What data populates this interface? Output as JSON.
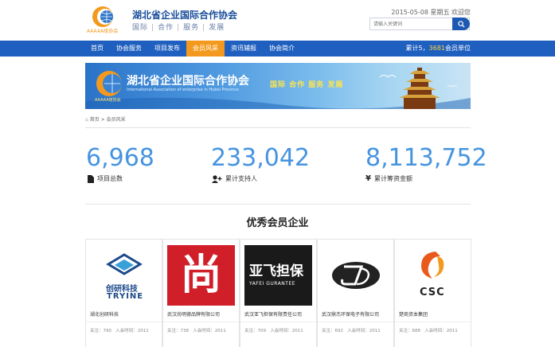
{
  "header": {
    "site_name": "湖北省企业国际合作协会",
    "slogan": [
      "国际",
      "合作",
      "服务",
      "发展"
    ],
    "logo_caption": "AAAAA级协会",
    "date_text": "2015-05-08 星期五 欢迎您",
    "search_placeholder": "请输入关键词"
  },
  "nav": {
    "items": [
      "首页",
      "协会服务",
      "项目发布",
      "会员风采",
      "资讯辅报",
      "协会简介"
    ],
    "active_index": 3,
    "stat_prefix": "累计5，",
    "stat_count": "3681",
    "stat_suffix": "会员单位"
  },
  "banner": {
    "title": "湖北省企业国际合作协会",
    "subtitle": "International Association of enterprise in Hubei Province",
    "badge": "AAAAA级协会",
    "slogan": "国际 合作 服务 发展"
  },
  "breadcrumb": {
    "home": "首页",
    "sep": ">",
    "current": "会员风采"
  },
  "stats": [
    {
      "value": "6,968",
      "label": "项目总数",
      "icon": "document-icon"
    },
    {
      "value": "233,042",
      "label": "累计支持人",
      "icon": "add-user-icon"
    },
    {
      "value": "8,113,752",
      "label": "累计筹资金额",
      "icon": "yen-icon"
    }
  ],
  "members_title": "优秀会员企业",
  "members": [
    {
      "name": "湖北创研科技",
      "views": "关注：790",
      "join": "入会时间：2011",
      "logo_top": "创研科技",
      "logo_bottom": "TRYINE"
    },
    {
      "name": "武汉尚明德品牌有限公司",
      "views": "关注：738",
      "join": "入会时间：2011",
      "logo_top": "尚"
    },
    {
      "name": "武汉亚飞担保有限责任公司",
      "views": "关注：709",
      "join": "入会时间：2011",
      "logo_top": "亚飞担保",
      "logo_bottom": "YAFEI GURANTEE"
    },
    {
      "name": "武汉鼎杰环保电子有限公司",
      "views": "关注：692",
      "join": "入会时间：2011"
    },
    {
      "name": "楚商资本集团",
      "views": "关注：688",
      "join": "入会时间：2011",
      "logo_bottom": "CSC"
    }
  ],
  "colors": {
    "nav_bg": "#1f5fbf",
    "nav_active": "#f39a1e",
    "stat_blue": "#4694e0"
  }
}
